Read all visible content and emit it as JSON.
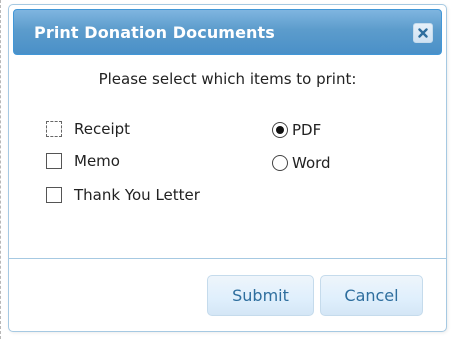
{
  "dialog": {
    "title": "Print Donation Documents",
    "close_icon": "close-icon",
    "prompt": "Please select which items to print:"
  },
  "items": [
    {
      "label": "Receipt",
      "checked": false,
      "focused": true
    },
    {
      "label": "Memo",
      "checked": false,
      "focused": false
    },
    {
      "label": "Thank You Letter",
      "checked": false,
      "focused": false
    }
  ],
  "formats": [
    {
      "label": "PDF",
      "selected": true
    },
    {
      "label": "Word",
      "selected": false
    }
  ],
  "buttons": {
    "submit_label": "Submit",
    "cancel_label": "Cancel"
  },
  "colors": {
    "titlebar": "#5c9ccc",
    "border": "#a6c9e2",
    "button_text": "#2e6e9e"
  }
}
